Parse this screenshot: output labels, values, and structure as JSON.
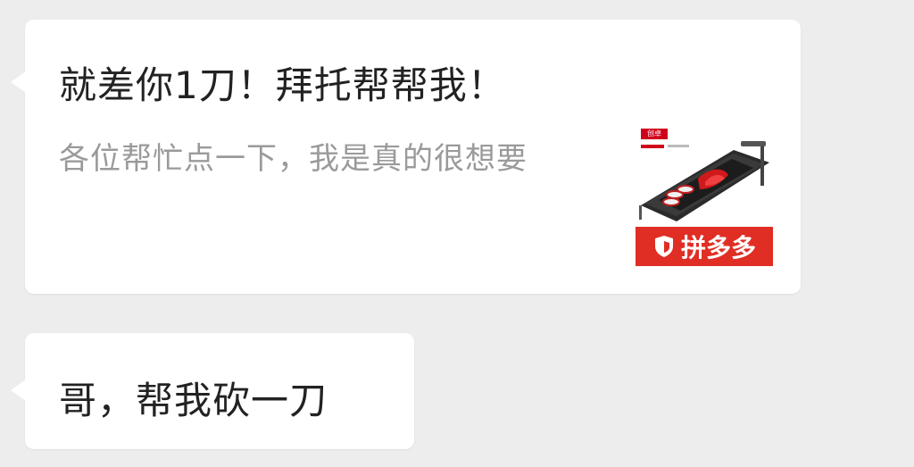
{
  "messages": [
    {
      "type": "link_card",
      "title": "就差你1刀！拜托帮帮我！",
      "description": "各位帮忙点一下，我是真的很想要",
      "thumbnail": {
        "brand": "拼多多",
        "tag": "创卓",
        "brand_color": "#e02e24"
      }
    },
    {
      "type": "text",
      "text": "哥，帮我砍一刀"
    }
  ],
  "colors": {
    "background": "#ededed",
    "bubble": "#ffffff",
    "title_text": "#222222",
    "desc_text": "#9a9a9a"
  }
}
